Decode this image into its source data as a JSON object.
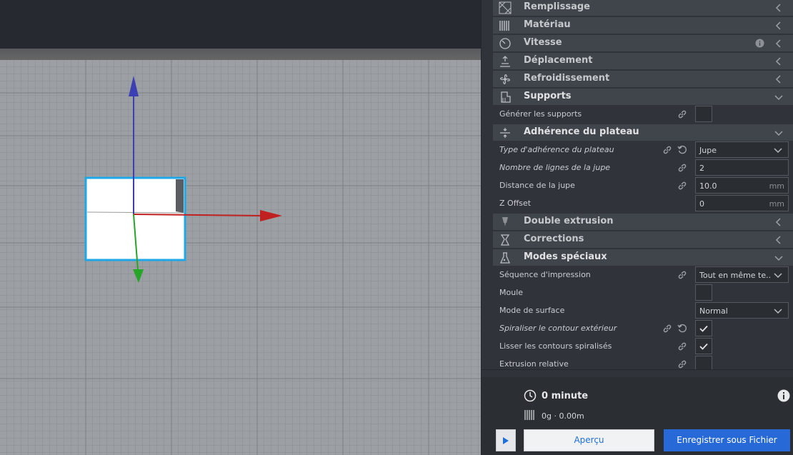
{
  "sections_top": [
    {
      "label": "Remplissage",
      "icon": "infill-icon",
      "state": "collapsed"
    },
    {
      "label": "Matériau",
      "icon": "material-icon",
      "state": "collapsed"
    },
    {
      "label": "Vitesse",
      "icon": "speed-icon",
      "state": "collapsed",
      "info": true
    },
    {
      "label": "Déplacement",
      "icon": "travel-icon",
      "state": "collapsed"
    },
    {
      "label": "Refroidissement",
      "icon": "fan-icon",
      "state": "collapsed"
    }
  ],
  "supports": {
    "label": "Supports",
    "settings": {
      "generate_label": "Générer les supports"
    }
  },
  "adhesion": {
    "label": "Adhérence du plateau",
    "type_label": "Type d'adhérence du plateau",
    "type_value": "Jupe",
    "skirt_lines_label": "Nombre de lignes de la jupe",
    "skirt_lines_value": "2",
    "skirt_distance_label": "Distance de la jupe",
    "skirt_distance_value": "10.0",
    "skirt_distance_unit": "mm",
    "z_offset_label": "Z Offset",
    "z_offset_value": "0",
    "z_offset_unit": "mm"
  },
  "sections_mid": [
    {
      "label": "Double extrusion",
      "icon": "dual-extrusion-icon",
      "state": "collapsed"
    },
    {
      "label": "Corrections",
      "icon": "mesh-fixes-icon",
      "state": "collapsed"
    }
  ],
  "special": {
    "label": "Modes spéciaux",
    "sequence_label": "Séquence d'impression",
    "sequence_value": "Tout en même te...",
    "mold_label": "Moule",
    "surface_label": "Mode de surface",
    "surface_value": "Normal",
    "spiralize_label": "Spiraliser le contour extérieur",
    "spiralize_checked": true,
    "smooth_label": "Lisser les contours spiralisés",
    "smooth_checked": true,
    "relative_label": "Extrusion relative"
  },
  "estimate": {
    "time": "0 minute",
    "material": "0g · 0.00m"
  },
  "buttons": {
    "preview": "Aperçu",
    "save": "Enregistrer sous Fichier"
  },
  "colors": {
    "accent": "#2769d6",
    "selection_outline": "#1fa8e8",
    "axis_x": "#c0201f",
    "axis_y": "#27a527",
    "axis_z": "#3b3fb3"
  }
}
